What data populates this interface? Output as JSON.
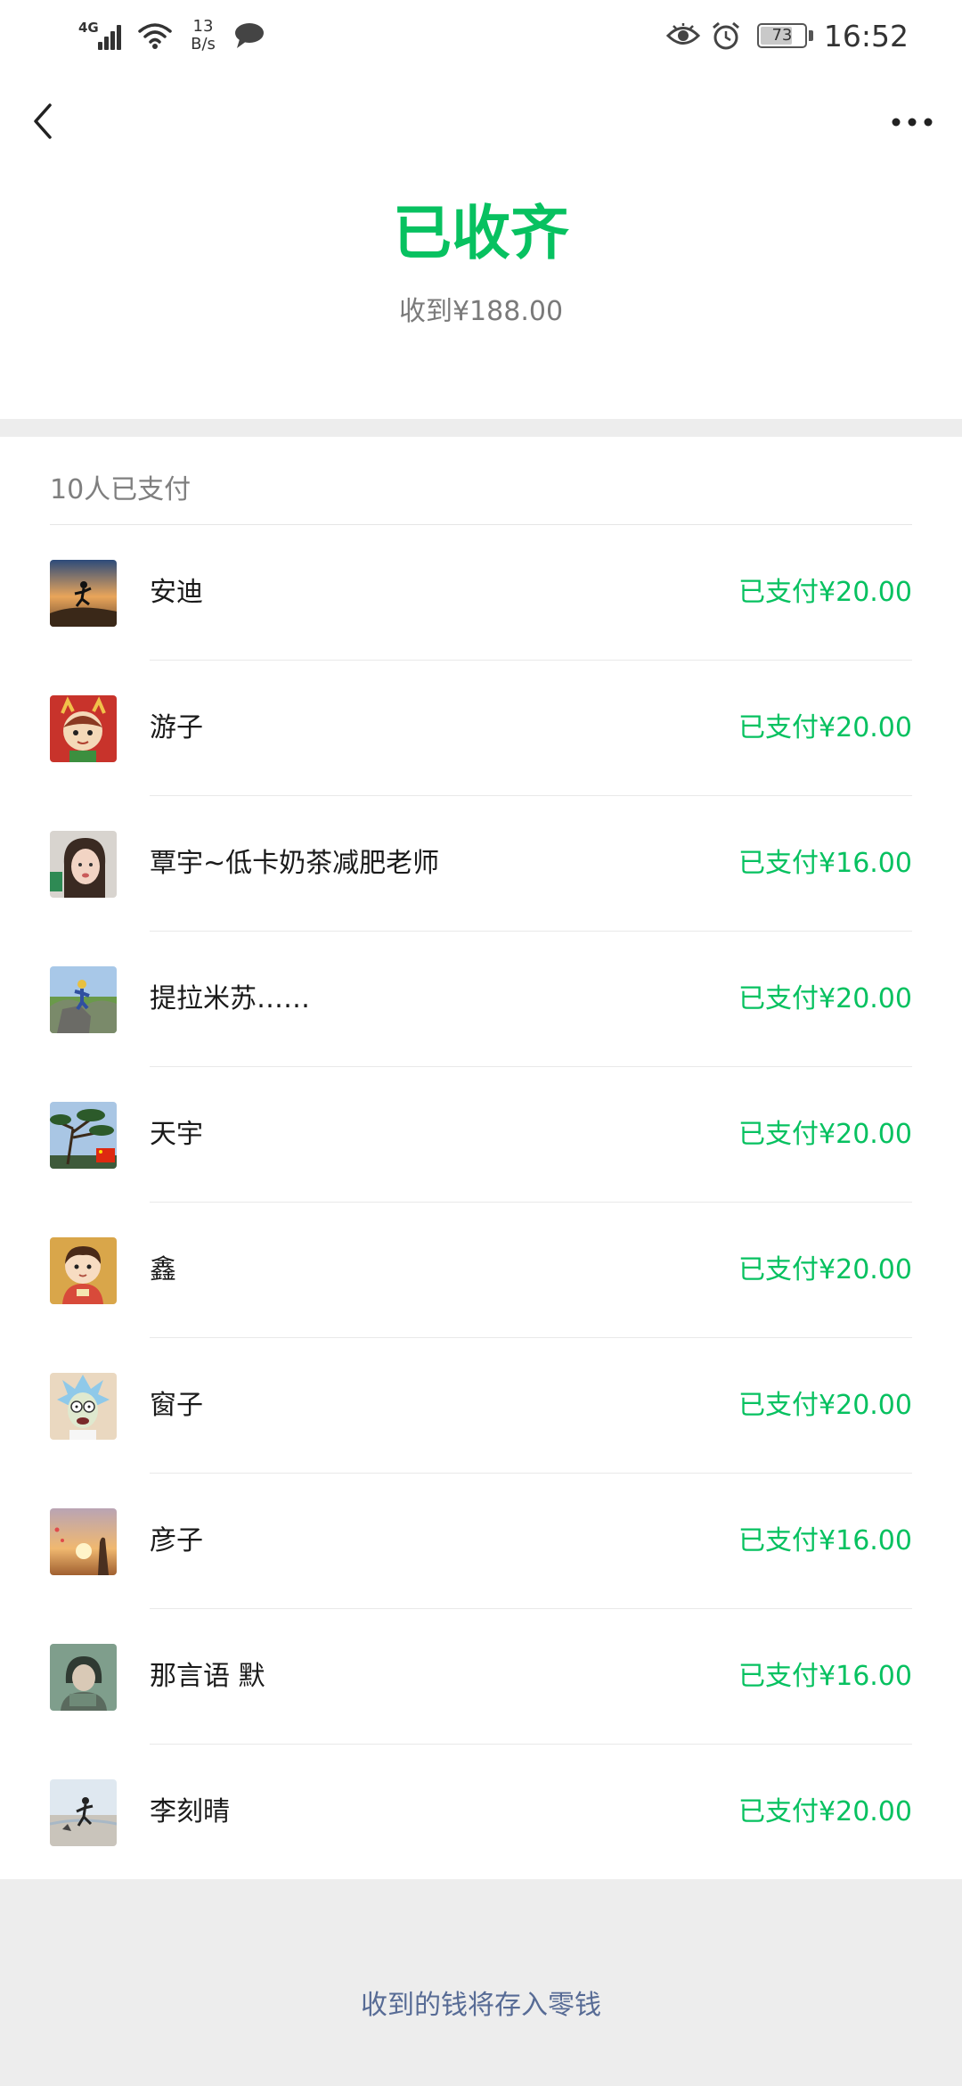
{
  "status_bar": {
    "network_type": "4G",
    "net_speed_value": "13",
    "net_speed_unit": "B/s",
    "battery_level": "73",
    "battery_fraction": 0.73,
    "time": "16:52"
  },
  "icons": {
    "back": "back-arrow-icon",
    "more": "more-dots-icon",
    "chat": "chat-bubble-icon",
    "eye": "eye-icon",
    "alarm": "alarm-icon"
  },
  "colors": {
    "accent": "#07c160",
    "link": "#576b95",
    "muted": "#7f7f7f",
    "band": "#ededed"
  },
  "header": {
    "title": "已收齐",
    "total_received": "收到¥188.00"
  },
  "summary": {
    "paid_count_label": "10人已支付"
  },
  "payers": [
    {
      "name": "安迪",
      "status": "已支付¥20.00"
    },
    {
      "name": "游子",
      "status": "已支付¥20.00"
    },
    {
      "name": "覃宇~低卡奶茶减肥老师",
      "status": "已支付¥16.00"
    },
    {
      "name": "提拉米苏……",
      "status": "已支付¥20.00"
    },
    {
      "name": "天宇",
      "status": "已支付¥20.00"
    },
    {
      "name": "鑫",
      "status": "已支付¥20.00"
    },
    {
      "name": "窗子",
      "status": "已支付¥20.00"
    },
    {
      "name": "彦子",
      "status": "已支付¥16.00"
    },
    {
      "name": "那言语  默",
      "status": "已支付¥16.00"
    },
    {
      "name": "李刻晴",
      "status": "已支付¥20.00"
    }
  ],
  "footer": {
    "link_text": "收到的钱将存入零钱"
  }
}
